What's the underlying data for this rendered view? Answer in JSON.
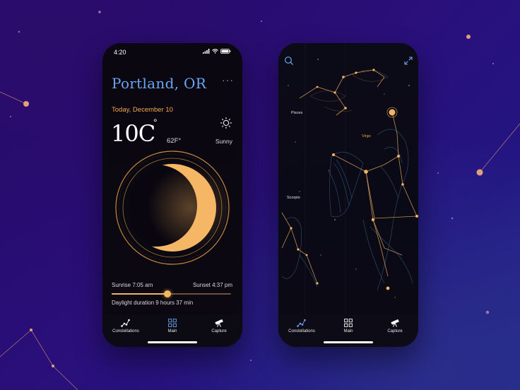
{
  "weather_app": {
    "status_time": "4:20",
    "city": "Portland, OR",
    "more": "···",
    "date": "Today, December 10",
    "temp_c": "10C",
    "temp_deg": "°",
    "temp_f": "62F°",
    "condition": "Sunny",
    "sunrise": "Sunrise 7:05 am",
    "sunset": "Sunset 4:37 pm",
    "daylight": "Daylight duration 9 hours 37 min",
    "daylight_progress": 0.47,
    "tabs": [
      {
        "label": "Constellations",
        "icon": "constellation-icon"
      },
      {
        "label": "Main",
        "icon": "grid-icon"
      },
      {
        "label": "Capture",
        "icon": "telescope-icon"
      }
    ]
  },
  "sky_app": {
    "labels": {
      "pisces": "Pisces",
      "virgo": "Virgo",
      "scorpio": "Scorpio"
    },
    "tabs": [
      {
        "label": "Constellations",
        "icon": "constellation-icon"
      },
      {
        "label": "Main",
        "icon": "grid-icon"
      },
      {
        "label": "Capture",
        "icon": "telescope-icon"
      }
    ]
  },
  "colors": {
    "accent_blue": "#6aa5f2",
    "accent_orange": "#f0a94f",
    "background": "#250b6e"
  }
}
